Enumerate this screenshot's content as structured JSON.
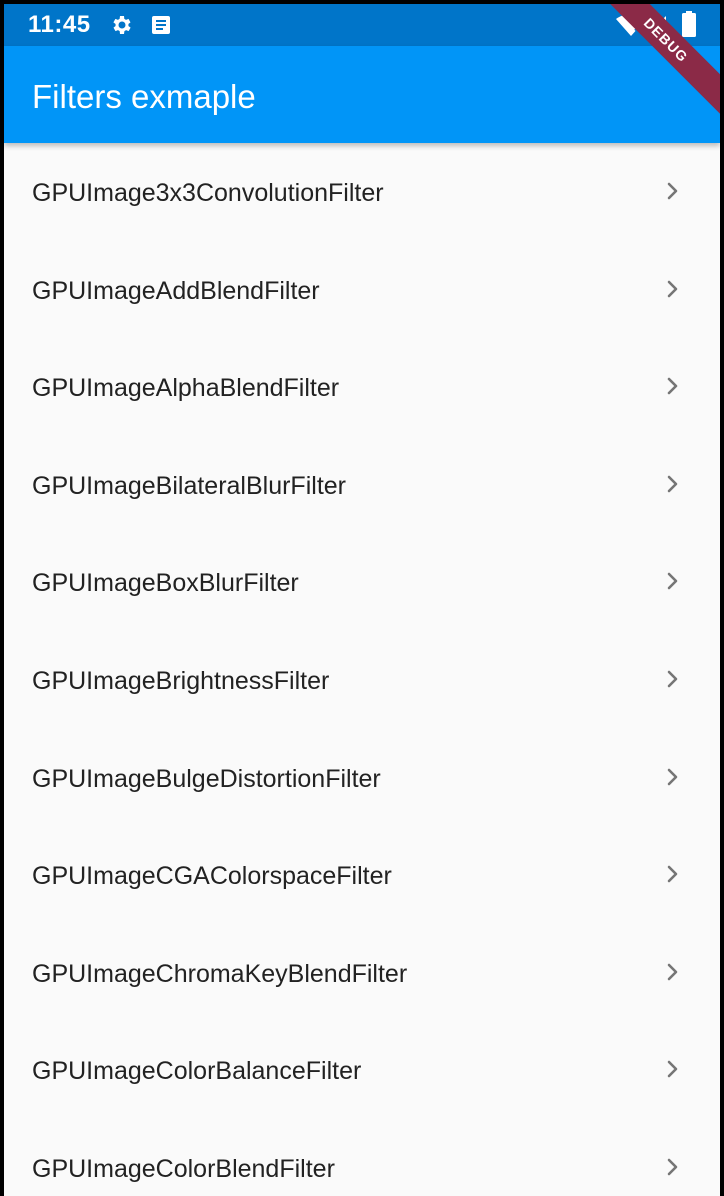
{
  "status_bar": {
    "time": "11:45",
    "icons": [
      "gear-icon",
      "notes-icon",
      "wifi-icon",
      "signal-icon",
      "battery-icon"
    ]
  },
  "app_bar": {
    "title": "Filters exmaple"
  },
  "debug_banner": {
    "label": "DEBUG"
  },
  "list": {
    "items": [
      {
        "label": "GPUImage3x3ConvolutionFilter"
      },
      {
        "label": "GPUImageAddBlendFilter"
      },
      {
        "label": "GPUImageAlphaBlendFilter"
      },
      {
        "label": "GPUImageBilateralBlurFilter"
      },
      {
        "label": "GPUImageBoxBlurFilter"
      },
      {
        "label": "GPUImageBrightnessFilter"
      },
      {
        "label": "GPUImageBulgeDistortionFilter"
      },
      {
        "label": "GPUImageCGAColorspaceFilter"
      },
      {
        "label": "GPUImageChromaKeyBlendFilter"
      },
      {
        "label": "GPUImageColorBalanceFilter"
      },
      {
        "label": "GPUImageColorBlendFilter"
      }
    ]
  },
  "colors": {
    "status_bar": "#0075c9",
    "app_bar": "#0195f7",
    "background": "#fafafa",
    "debug_banner": "#8b2a47",
    "chevron": "#757575"
  }
}
